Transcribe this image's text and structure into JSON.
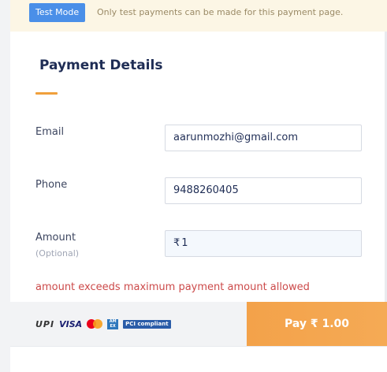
{
  "banner": {
    "badge": "Test Mode",
    "message": "Only test payments can be made for this payment page."
  },
  "form": {
    "title": "Payment Details",
    "email": {
      "label": "Email",
      "value": "aarunmozhi@gmail.com"
    },
    "phone": {
      "label": "Phone",
      "value": "9488260405"
    },
    "amount": {
      "label": "Amount",
      "sublabel": "(Optional)",
      "currency": "₹",
      "value": "1"
    },
    "error": "amount exceeds maximum payment amount allowed"
  },
  "footer": {
    "logos": {
      "upi": "UPI",
      "visa": "VISA",
      "amex": "AM EX",
      "pci": "PCI compliant"
    },
    "pay_label": "Pay  ₹ 1.00"
  },
  "colors": {
    "accent": "#f3a24a",
    "badge": "#4a8fe8",
    "error": "#cc4a4a",
    "title": "#1f2d55"
  }
}
